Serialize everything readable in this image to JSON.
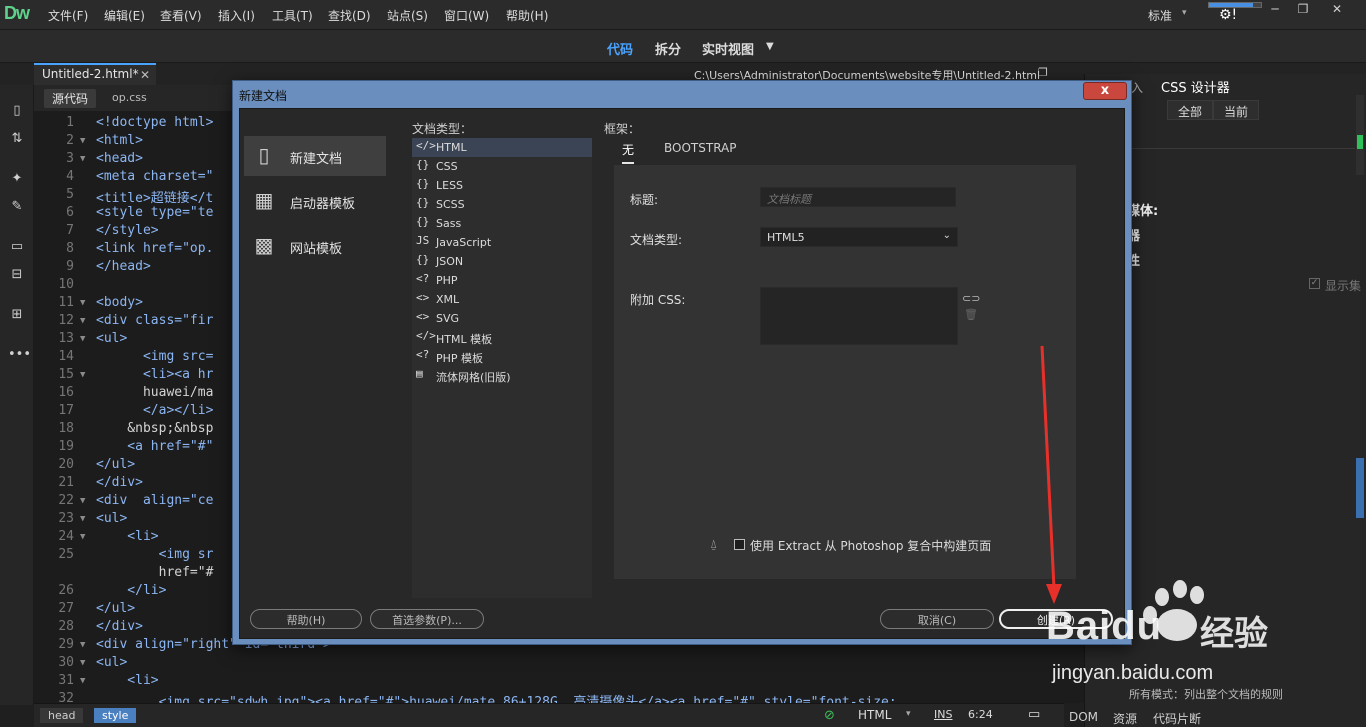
{
  "app": {
    "logo": "Dw",
    "menu": [
      "文件(F)",
      "编辑(E)",
      "查看(V)",
      "插入(I)",
      "工具(T)",
      "查找(D)",
      "站点(S)",
      "窗口(W)",
      "帮助(H)"
    ],
    "workspace": "标准",
    "sync_progress": 0.85
  },
  "view_modes": {
    "code": "代码",
    "split": "拆分",
    "live": "实时视图"
  },
  "document": {
    "tab_name": "Untitled-2.html*",
    "path": "C:\\Users\\Administrator\\Documents\\website专用\\Untitled-2.html",
    "source_tab": "源代码",
    "related_file": "op.css"
  },
  "code_lines": [
    {
      "n": "1",
      "fold": "",
      "text": "<!doctype html>"
    },
    {
      "n": "2",
      "fold": "▼",
      "text": "<html>"
    },
    {
      "n": "3",
      "fold": "▼",
      "text": "<head>"
    },
    {
      "n": "4",
      "fold": "",
      "text": "<meta charset=\""
    },
    {
      "n": "5",
      "fold": "",
      "text": "<title>超链接</t"
    },
    {
      "n": "6",
      "fold": "",
      "text": "<style type=\"te"
    },
    {
      "n": "7",
      "fold": "",
      "text": "</style>"
    },
    {
      "n": "8",
      "fold": "",
      "text": "<link href=\"op."
    },
    {
      "n": "9",
      "fold": "",
      "text": "</head>"
    },
    {
      "n": "10",
      "fold": "",
      "text": ""
    },
    {
      "n": "11",
      "fold": "▼",
      "text": "<body>"
    },
    {
      "n": "12",
      "fold": "▼",
      "text": "<div class=\"fir"
    },
    {
      "n": "13",
      "fold": "▼",
      "text": "<ul>"
    },
    {
      "n": "14",
      "fold": "",
      "text": "      <img src="
    },
    {
      "n": "15",
      "fold": "▼",
      "text": "      <li><a hr"
    },
    {
      "n": "16",
      "fold": "",
      "text": "      huawei/ma"
    },
    {
      "n": "17",
      "fold": "",
      "text": "      </a></li>"
    },
    {
      "n": "18",
      "fold": "",
      "text": "    &nbsp;&nbsp"
    },
    {
      "n": "19",
      "fold": "",
      "text": "    <a href=\"#\""
    },
    {
      "n": "20",
      "fold": "",
      "text": "</ul>"
    },
    {
      "n": "21",
      "fold": "",
      "text": "</div>"
    },
    {
      "n": "22",
      "fold": "▼",
      "text": "<div  align=\"ce"
    },
    {
      "n": "23",
      "fold": "▼",
      "text": "<ul>"
    },
    {
      "n": "24",
      "fold": "▼",
      "text": "    <li>"
    },
    {
      "n": "25",
      "fold": "",
      "text": "        <img sr"
    },
    {
      "n": "",
      "fold": "",
      "text": "        href=\"#"
    },
    {
      "n": "26",
      "fold": "",
      "text": "    </li>"
    },
    {
      "n": "27",
      "fold": "",
      "text": "</ul>"
    },
    {
      "n": "28",
      "fold": "",
      "text": "</div>"
    },
    {
      "n": "29",
      "fold": "▼",
      "text": "<div align=\"right\" id=\"third\">"
    },
    {
      "n": "30",
      "fold": "▼",
      "text": "<ul>"
    },
    {
      "n": "31",
      "fold": "▼",
      "text": "    <li>"
    },
    {
      "n": "32",
      "fold": "",
      "text": "        <img src=\"sdwh.jpg\"><a href=\"#\">huawei/mate 86+128G  高清摄像头</a><a href=\"#\" style=\"font-size:"
    }
  ],
  "status": {
    "breadcrumbs": [
      "head",
      "style"
    ],
    "language": "HTML",
    "mode": "INS",
    "position": "6:24"
  },
  "right_panel": {
    "insert_tab": "入",
    "css_tab": "CSS 设计器",
    "all_button": "全部",
    "current_button": "当前",
    "label_media": "媒体:",
    "label_selector": "器",
    "label_property": "性",
    "show_set": "显示集",
    "status_text": "所有模式：列出整个文档的规则",
    "bottom_tabs": [
      "DOM",
      "资源",
      "代码片断"
    ]
  },
  "dialog": {
    "title": "新建文档",
    "close": "x",
    "categories": [
      "新建文档",
      "启动器模板",
      "网站模板"
    ],
    "doc_type_header": "文档类型：",
    "doc_types": [
      {
        "icon": "</>",
        "label": "HTML"
      },
      {
        "icon": "{}",
        "label": "CSS"
      },
      {
        "icon": "{}",
        "label": "LESS"
      },
      {
        "icon": "{}",
        "label": "SCSS"
      },
      {
        "icon": "{}",
        "label": "Sass"
      },
      {
        "icon": "JS",
        "label": "JavaScript"
      },
      {
        "icon": "{}",
        "label": "JSON"
      },
      {
        "icon": "<?",
        "label": "PHP"
      },
      {
        "icon": "<>",
        "label": "XML"
      },
      {
        "icon": "<>",
        "label": "SVG"
      },
      {
        "icon": "</>",
        "label": "HTML 模板"
      },
      {
        "icon": "<?",
        "label": "PHP 模板"
      },
      {
        "icon": "▤",
        "label": "流体网格(旧版)"
      }
    ],
    "framework_header": "框架：",
    "framework_tabs": [
      "无",
      "BOOTSTRAP"
    ],
    "title_label": "标题:",
    "title_placeholder": "文档标题",
    "doctype_label": "文档类型:",
    "doctype_value": "HTML5",
    "css_label": "附加 CSS:",
    "extract_label": "使用 Extract 从 Photoshop 复合中构建页面",
    "buttons": {
      "help": "帮助(H)",
      "prefs": "首选参数(P)...",
      "cancel": "取消(C)",
      "create": "创建(R)"
    }
  },
  "watermark": {
    "brand": "Baidu",
    "product": "经验",
    "url": "jingyan.baidu.com"
  }
}
